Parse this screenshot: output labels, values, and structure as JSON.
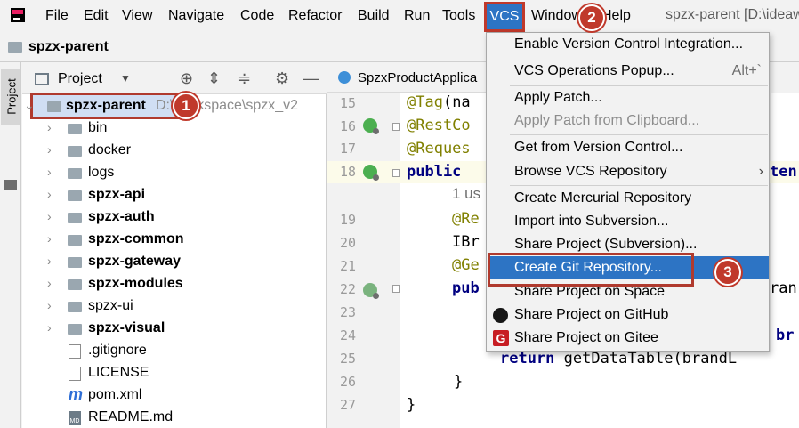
{
  "menubar": {
    "items": [
      "File",
      "Edit",
      "View",
      "Navigate",
      "Code",
      "Refactor",
      "Build",
      "Run",
      "Tools",
      "VCS",
      "Window",
      "Help"
    ],
    "window_title": "spzx-parent [D:\\ideaw"
  },
  "breadcrumb": {
    "label": "spzx-parent"
  },
  "toolstrip": {
    "label": "Project"
  },
  "project_panel": {
    "title": "Project",
    "root": {
      "label": "spzx-parent",
      "path": "D:\\workspace\\spzx_v2"
    },
    "items": [
      {
        "label": "bin",
        "type": "folder",
        "bold": false
      },
      {
        "label": "docker",
        "type": "folder",
        "bold": false
      },
      {
        "label": "logs",
        "type": "folder",
        "bold": false
      },
      {
        "label": "spzx-api",
        "type": "folder",
        "bold": true
      },
      {
        "label": "spzx-auth",
        "type": "folder",
        "bold": true
      },
      {
        "label": "spzx-common",
        "type": "folder",
        "bold": true
      },
      {
        "label": "spzx-gateway",
        "type": "folder",
        "bold": true
      },
      {
        "label": "spzx-modules",
        "type": "folder",
        "bold": true
      },
      {
        "label": "spzx-ui",
        "type": "folder",
        "bold": false
      },
      {
        "label": "spzx-visual",
        "type": "folder",
        "bold": true
      },
      {
        "label": ".gitignore",
        "type": "file",
        "bold": false
      },
      {
        "label": "LICENSE",
        "type": "file",
        "bold": false
      },
      {
        "label": "pom.xml",
        "type": "maven",
        "bold": false
      },
      {
        "label": "README.md",
        "type": "markdown",
        "bold": false
      }
    ]
  },
  "editor": {
    "tab_label": "SpzxProductApplica",
    "line_numbers": [
      "15",
      "16",
      "17",
      "18",
      "",
      "19",
      "20",
      "21",
      "22",
      "23",
      "24",
      "25",
      "26",
      "27"
    ],
    "code": {
      "l15_ann": "@Tag",
      "l15_rest": "(na",
      "l16_ann": "@RestCo",
      "l17_ann": "@Reques",
      "l18_kw": "public",
      "l18_right": "ten",
      "usages": "1 us",
      "l19_ann": "@Re",
      "l20_text": "IBr",
      "l21_ann": "@Ge",
      "l22_kw": "pub",
      "l22_right": "ran",
      "l24_right": "br",
      "l25_kw": "return",
      "l25_rest": "getDataTable(brandL",
      "l26": "}",
      "l27": "}"
    }
  },
  "vcs_menu": {
    "items": [
      {
        "label": "Enable Version Control Integration...",
        "state": "normal"
      },
      {
        "label": "VCS Operations Popup...",
        "state": "normal",
        "shortcut": "Alt+`"
      },
      {
        "label": "Apply Patch...",
        "state": "normal"
      },
      {
        "label": "Apply Patch from Clipboard...",
        "state": "disabled"
      },
      {
        "label": "Get from Version Control...",
        "state": "normal"
      },
      {
        "label": "Browse VCS Repository",
        "state": "normal",
        "submenu": true
      },
      {
        "label": "Create Mercurial Repository",
        "state": "normal"
      },
      {
        "label": "Import into Subversion...",
        "state": "normal"
      },
      {
        "label": "Share Project (Subversion)...",
        "state": "normal"
      },
      {
        "label": "Create Git Repository...",
        "state": "selected"
      },
      {
        "label": "Share Project on Space",
        "state": "normal"
      },
      {
        "label": "Share Project on GitHub",
        "state": "normal",
        "icon": "github-icon"
      },
      {
        "label": "Share Project on Gitee",
        "state": "normal",
        "icon": "gitee-icon"
      }
    ]
  },
  "callouts": [
    "1",
    "2",
    "3"
  ],
  "colors": {
    "accent": "#2d74c4",
    "callout": "#c0392b"
  }
}
